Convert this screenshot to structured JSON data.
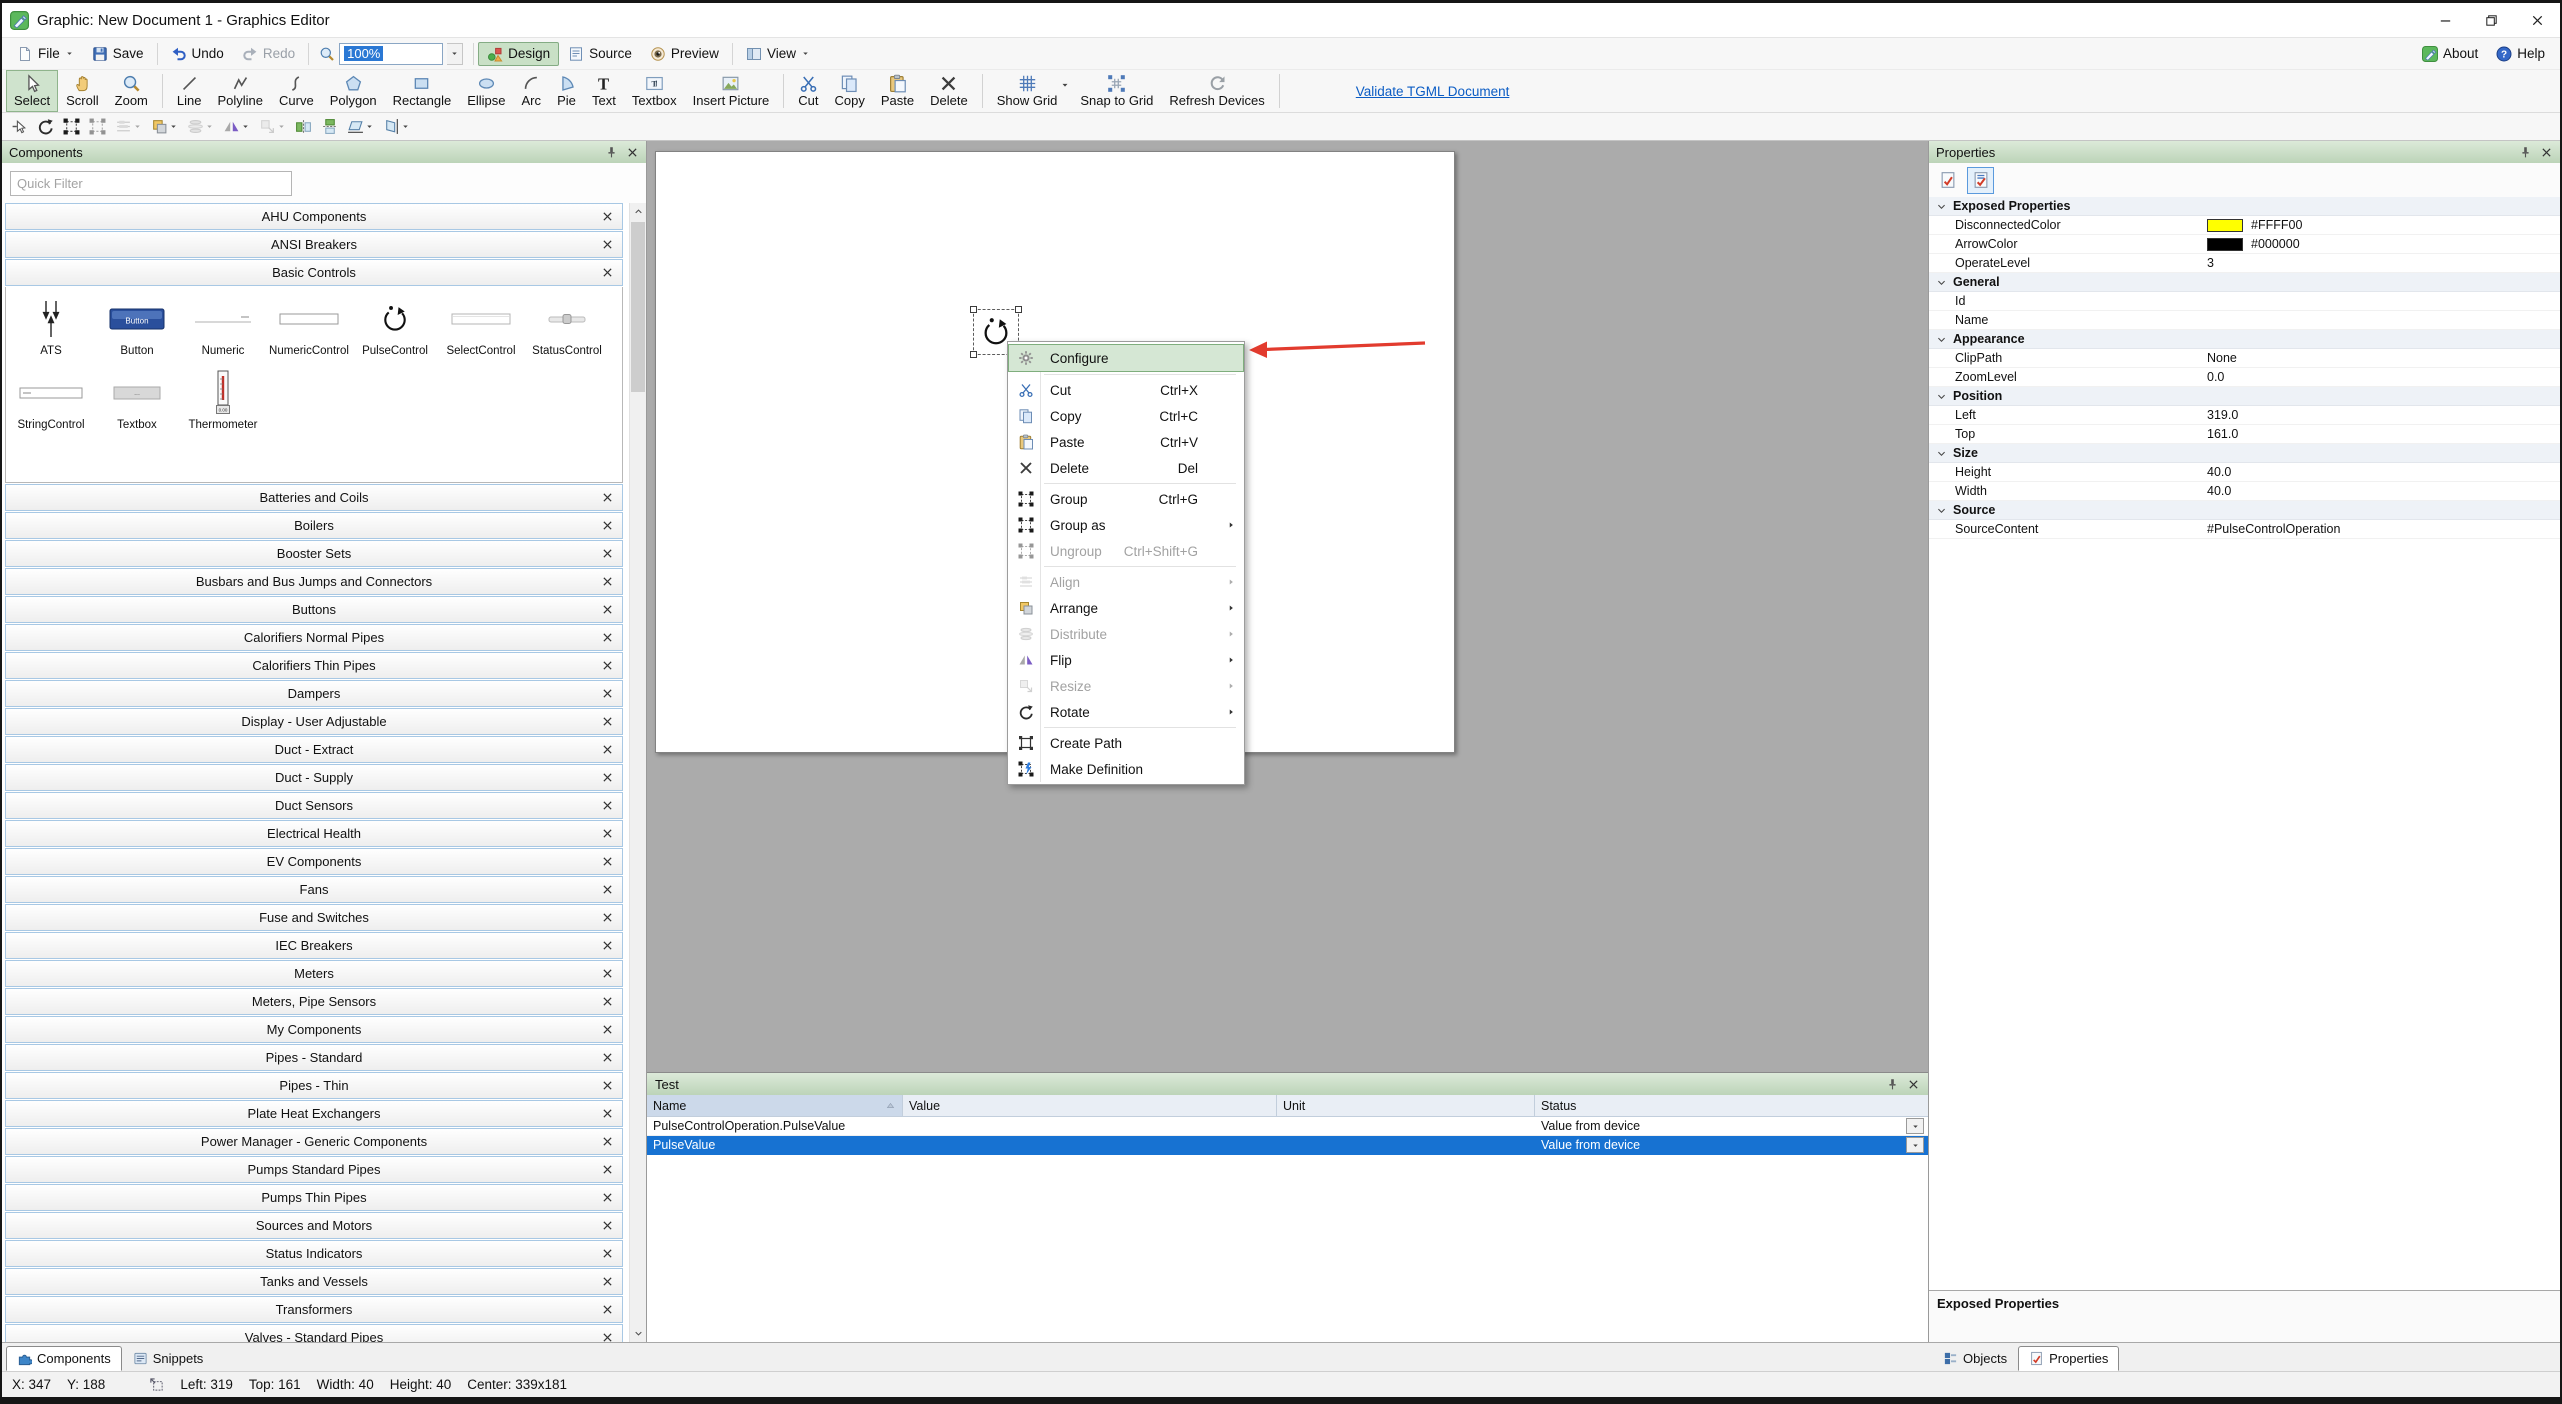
{
  "window": {
    "title": "Graphic: New Document 1 - Graphics Editor",
    "about": "About",
    "help": "Help"
  },
  "menubar": {
    "file": "File",
    "save": "Save",
    "undo": "Undo",
    "redo": "Redo",
    "zoom_value": "100%",
    "design": "Design",
    "source": "Source",
    "preview": "Preview",
    "view": "View"
  },
  "toolbar": {
    "tools": [
      {
        "label": "Select",
        "icon": "select",
        "active": true
      },
      {
        "label": "Scroll",
        "icon": "scroll"
      },
      {
        "label": "Zoom",
        "icon": "zoom",
        "sep_after": true
      },
      {
        "label": "Line",
        "icon": "line"
      },
      {
        "label": "Polyline",
        "icon": "polyline"
      },
      {
        "label": "Curve",
        "icon": "curve"
      },
      {
        "label": "Polygon",
        "icon": "polygon"
      },
      {
        "label": "Rectangle",
        "icon": "rectangle"
      },
      {
        "label": "Ellipse",
        "icon": "ellipse"
      },
      {
        "label": "Arc",
        "icon": "arc"
      },
      {
        "label": "Pie",
        "icon": "pie"
      },
      {
        "label": "Text",
        "icon": "text"
      },
      {
        "label": "Textbox",
        "icon": "textbox"
      },
      {
        "label": "Insert Picture",
        "icon": "picture",
        "sep_after": true
      },
      {
        "label": "Cut",
        "icon": "cut"
      },
      {
        "label": "Copy",
        "icon": "copy"
      },
      {
        "label": "Paste",
        "icon": "paste"
      },
      {
        "label": "Delete",
        "icon": "delete",
        "sep_after": true
      },
      {
        "label": "Show Grid",
        "icon": "grid",
        "caret": true
      },
      {
        "label": "Snap to Grid",
        "icon": "snapgrid"
      },
      {
        "label": "Refresh Devices",
        "icon": "refresh",
        "sep_after": true
      }
    ],
    "validate_link": "Validate TGML Document"
  },
  "edit_toolbar": {
    "buttons": [
      {
        "icon": "pointer-pin"
      },
      {
        "icon": "rotate"
      },
      {
        "icon": "group"
      },
      {
        "icon": "ungroup",
        "disabled": true
      },
      {
        "icon": "align",
        "disabled": true,
        "caret": true
      },
      {
        "icon": "arrange",
        "caret": true
      },
      {
        "icon": "distribute",
        "disabled": true,
        "caret": true
      },
      {
        "icon": "flip",
        "caret": true
      },
      {
        "icon": "resize",
        "disabled": true,
        "caret": true
      },
      {
        "icon": "flip-horizontal"
      },
      {
        "icon": "flip-vertical"
      },
      {
        "icon": "skew-horizontal",
        "caret": true
      },
      {
        "icon": "skew-vertical",
        "caret": true
      }
    ]
  },
  "components_panel": {
    "title": "Components",
    "quick_filter_placeholder": "Quick Filter",
    "top_categories": [
      "AHU Components",
      "ANSI Breakers"
    ],
    "expanded_category": "Basic Controls",
    "items": [
      {
        "label": "ATS",
        "icon": "ats"
      },
      {
        "label": "Button",
        "icon": "button"
      },
      {
        "label": "Numeric",
        "icon": "numeric"
      },
      {
        "label": "NumericControl",
        "icon": "numeric-control"
      },
      {
        "label": "PulseControl",
        "icon": "pulse-control"
      },
      {
        "label": "SelectControl",
        "icon": "select-control"
      },
      {
        "label": "StatusControl",
        "icon": "status-control"
      },
      {
        "label": "StringControl",
        "icon": "string-control"
      },
      {
        "label": "Textbox",
        "icon": "textbox-item"
      },
      {
        "label": "Thermometer",
        "icon": "thermometer"
      }
    ],
    "categories": [
      "Batteries and Coils",
      "Boilers",
      "Booster Sets",
      "Busbars and Bus Jumps and Connectors",
      "Buttons",
      "Calorifiers Normal Pipes",
      "Calorifiers Thin Pipes",
      "Dampers",
      "Display - User Adjustable",
      "Duct - Extract",
      "Duct - Supply",
      "Duct Sensors",
      "Electrical Health",
      "EV Components",
      "Fans",
      "Fuse and Switches",
      "IEC Breakers",
      "Meters",
      "Meters, Pipe Sensors",
      "My Components",
      "Pipes - Standard",
      "Pipes - Thin",
      "Plate Heat Exchangers",
      "Power Manager - Generic Components",
      "Pumps Standard Pipes",
      "Pumps Thin Pipes",
      "Sources and Motors",
      "Status Indicators",
      "Tanks and Vessels",
      "Transformers",
      "Valves - Standard Pipes"
    ],
    "tabs": [
      {
        "label": "Components",
        "icon": "puzzle",
        "active": true
      },
      {
        "label": "Snippets",
        "icon": "snippet",
        "active": false
      }
    ]
  },
  "workspace": {
    "selected_component": "PulseControl"
  },
  "context_menu": {
    "items": [
      {
        "label": "Configure",
        "icon": "gear",
        "highlight": true,
        "sep_after": true
      },
      {
        "label": "Cut",
        "icon": "cut",
        "shortcut": "Ctrl+X"
      },
      {
        "label": "Copy",
        "icon": "copy",
        "shortcut": "Ctrl+C"
      },
      {
        "label": "Paste",
        "icon": "paste",
        "shortcut": "Ctrl+V"
      },
      {
        "label": "Delete",
        "icon": "delete",
        "shortcut": "Del",
        "sep_after": true
      },
      {
        "label": "Group",
        "icon": "group",
        "shortcut": "Ctrl+G"
      },
      {
        "label": "Group as",
        "icon": "group-as",
        "submenu": true
      },
      {
        "label": "Ungroup",
        "icon": "ungroup",
        "shortcut": "Ctrl+Shift+G",
        "disabled": true,
        "sep_after": true
      },
      {
        "label": "Align",
        "icon": "align",
        "submenu": true,
        "disabled": true
      },
      {
        "label": "Arrange",
        "icon": "arrange",
        "submenu": true
      },
      {
        "label": "Distribute",
        "icon": "distribute",
        "submenu": true,
        "disabled": true
      },
      {
        "label": "Flip",
        "icon": "flip",
        "submenu": true
      },
      {
        "label": "Resize",
        "icon": "resize",
        "submenu": true,
        "disabled": true
      },
      {
        "label": "Rotate",
        "icon": "rotate",
        "submenu": true,
        "sep_after": true
      },
      {
        "label": "Create Path",
        "icon": "create-path"
      },
      {
        "label": "Make Definition",
        "icon": "make-definition"
      }
    ]
  },
  "test_panel": {
    "title": "Test",
    "columns": [
      "Name",
      "Value",
      "Unit",
      "Status"
    ],
    "rows": [
      {
        "name": "PulseControlOperation.PulseValue",
        "value": "",
        "unit": "",
        "status": "Value from device",
        "selected": false
      },
      {
        "name": "PulseValue",
        "value": "",
        "unit": "",
        "status": "Value from device",
        "selected": true
      }
    ]
  },
  "properties_panel": {
    "title": "Properties",
    "rows": [
      {
        "type": "group",
        "label": "Exposed Properties"
      },
      {
        "type": "prop",
        "label": "DisconnectedColor",
        "value": "#FFFF00",
        "swatch": "#FFFF00"
      },
      {
        "type": "prop",
        "label": "ArrowColor",
        "value": "#000000",
        "swatch": "#000000"
      },
      {
        "type": "prop",
        "label": "OperateLevel",
        "value": "3"
      },
      {
        "type": "group",
        "label": "General"
      },
      {
        "type": "prop",
        "label": "Id",
        "value": ""
      },
      {
        "type": "prop",
        "label": "Name",
        "value": ""
      },
      {
        "type": "group",
        "label": "Appearance"
      },
      {
        "type": "prop",
        "label": "ClipPath",
        "value": "None"
      },
      {
        "type": "prop",
        "label": "ZoomLevel",
        "value": "0.0"
      },
      {
        "type": "group",
        "label": "Position"
      },
      {
        "type": "prop",
        "label": "Left",
        "value": "319.0"
      },
      {
        "type": "prop",
        "label": "Top",
        "value": "161.0"
      },
      {
        "type": "group",
        "label": "Size"
      },
      {
        "type": "prop",
        "label": "Height",
        "value": "40.0"
      },
      {
        "type": "prop",
        "label": "Width",
        "value": "40.0"
      },
      {
        "type": "group",
        "label": "Source"
      },
      {
        "type": "prop",
        "label": "SourceContent",
        "value": "#PulseControlOperation"
      }
    ],
    "description": "Exposed Properties",
    "tabs": [
      {
        "label": "Objects",
        "icon": "objects",
        "active": false
      },
      {
        "label": "Properties",
        "icon": "prop-doc",
        "active": true
      }
    ]
  },
  "status_bar": {
    "x": "X: 347",
    "y": "Y: 188",
    "left": "Left: 319",
    "top": "Top: 161",
    "width": "Width: 40",
    "height": "Height: 40",
    "center": "Center: 339x181"
  },
  "colors": {
    "panel_header_green": "#c7dbc4",
    "active_mode_green": "#c9e0c6",
    "menu_highlight_green": "#d5e7d4",
    "selection_blue": "#1772d2",
    "workspace_gray": "#ababab",
    "link_blue": "#0b5cc4",
    "annotation_arrow_red": "#e23b2e",
    "disconnected_color": "#FFFF00",
    "arrow_color": "#000000"
  }
}
